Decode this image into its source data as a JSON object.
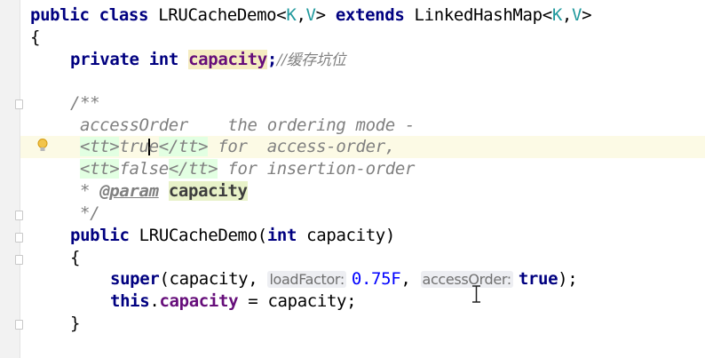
{
  "editor": {
    "line_class": [
      "public",
      "class",
      "LRUCacheDemo",
      "<",
      "K",
      ",",
      "V",
      ">",
      "extends",
      "LinkedHashMap",
      "<",
      "K",
      ",",
      "V",
      ">"
    ],
    "open_brace": "{",
    "close_brace": "}",
    "field_decl": {
      "kw1": "private",
      "kw2": "int",
      "name": "capacity",
      "semi": ";",
      "comment": "//缓存坑位"
    },
    "javadoc": {
      "open": "/**",
      "line1": "accessOrder    the ordering mode -",
      "line2_tag_open": "<tt>",
      "line2_val_a": "tru",
      "line2_val_b": "e",
      "line2_tag_close": "</tt>",
      "line2_rest": " for  access-order,",
      "line3_tag_open": "<tt>",
      "line3_val": "false",
      "line3_tag_close": "</tt>",
      "line3_rest": " for insertion-order",
      "line4_star": "* ",
      "line4_tag": "@param",
      "line4_param": "capacity",
      "close": "*/"
    },
    "ctor": {
      "kw": "public",
      "name": "LRUCacheDemo(",
      "kw2": "int",
      "rest": " capacity)"
    },
    "ctor_open": "{",
    "super_call": {
      "kw": "super",
      "open": "(capacity, ",
      "hint1": "loadFactor:",
      "num": "0.75F",
      "sep": ", ",
      "hint2": "accessOrder:",
      "kw2": "true",
      "close": ");"
    },
    "this_line": {
      "kw": "this",
      "dot": ".",
      "field": "capacity",
      "rest": " = capacity;"
    },
    "ctor_close": "}"
  }
}
